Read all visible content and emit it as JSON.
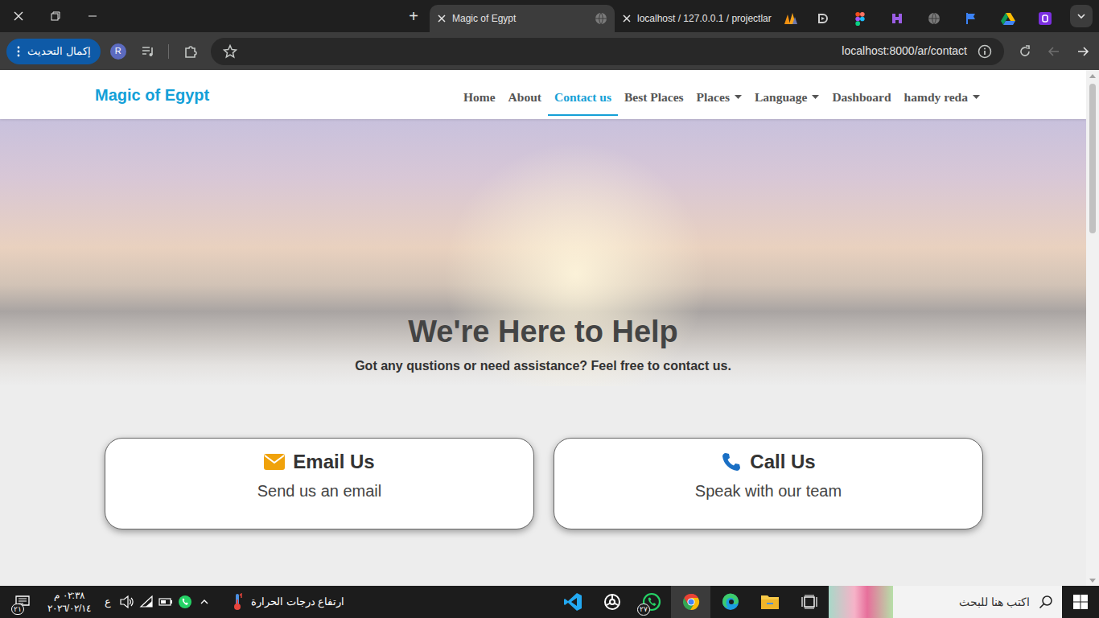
{
  "browser": {
    "new_tab": "+",
    "tabs": [
      {
        "label": "Magic of Egypt",
        "selected": true
      },
      {
        "label": "localhost / 127.0.0.1 / projectlar",
        "selected": false
      }
    ],
    "update_button": "إكمال التحديث",
    "profile_initial": "R",
    "url": "localhost:8000/ar/contact",
    "back_enabled": true,
    "forward_enabled": false
  },
  "page": {
    "logo": "Magic of Egypt",
    "nav": [
      {
        "label": "Home",
        "selected": false,
        "dropdown": false
      },
      {
        "label": "About",
        "selected": false,
        "dropdown": false
      },
      {
        "label": "Contact us",
        "selected": true,
        "dropdown": false
      },
      {
        "label": "Best Places",
        "selected": false,
        "dropdown": false
      },
      {
        "label": "Places",
        "selected": false,
        "dropdown": true
      },
      {
        "label": "Language",
        "selected": false,
        "dropdown": true
      },
      {
        "label": "Dashboard",
        "selected": false,
        "dropdown": false
      },
      {
        "label": "hamdy reda",
        "selected": false,
        "dropdown": true
      }
    ],
    "hero": {
      "title": "We're Here to Help",
      "subtitle": "Got any qustions or need assistance? Feel free to contact us."
    },
    "cards": [
      {
        "kind": "email",
        "title": "Email Us",
        "text": "Send us an email",
        "color": "#f0a20b"
      },
      {
        "kind": "phone",
        "title": "Call Us",
        "text": "Speak with our team",
        "color": "#1a6fc4"
      }
    ]
  },
  "taskbar": {
    "notifications": "٢١",
    "time": "٠٢:٣٨ م",
    "date": "٢٠٢٦/٠٢/١٤",
    "input_language": "ع",
    "weather": "ارتفاع درجات الحرارة",
    "apps": [
      {
        "selected": false,
        "badge": ""
      },
      {
        "selected": false,
        "badge": ""
      },
      {
        "selected": false,
        "badge": "٢٧"
      },
      {
        "selected": true,
        "badge": ""
      },
      {
        "selected": false,
        "badge": ""
      },
      {
        "selected": false,
        "badge": ""
      },
      {
        "selected": false,
        "badge": ""
      }
    ],
    "search_placeholder": "اكتب هنا للبحث"
  }
}
